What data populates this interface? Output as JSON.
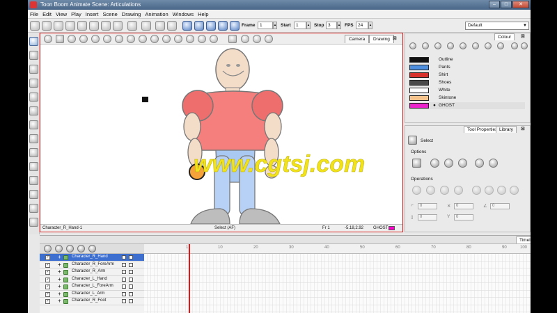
{
  "window": {
    "title": "Toon Boom Animate Scene: Articulations"
  },
  "menu": [
    "File",
    "Edit",
    "View",
    "Play",
    "Insert",
    "Scene",
    "Drawing",
    "Animation",
    "Windows",
    "Help"
  ],
  "toolbar": {
    "frame_label": "Frame",
    "frame_value": "1",
    "start_label": "Start",
    "start_value": "1",
    "stop_label": "Stop",
    "stop_value": "3",
    "fps_label": "FPS",
    "fps_value": "24",
    "workspace": "Default"
  },
  "view": {
    "tabs": [
      "Camera",
      "Drawing"
    ],
    "selected_tab": "Drawing",
    "status_left": "Character_R_Hand-1",
    "status_tool": "Select (AF)",
    "status_frame": "Fr 1",
    "status_coords": "-5.18,2.92",
    "status_color": "GHOST"
  },
  "colour_panel": {
    "tab": "Colour",
    "swatches": [
      {
        "name": "Outline",
        "color": "#111111"
      },
      {
        "name": "Pants",
        "color": "#4f8fe0"
      },
      {
        "name": "Shirt",
        "color": "#d8302a"
      },
      {
        "name": "Shoes",
        "color": "#4a4a4a"
      },
      {
        "name": "White",
        "color": "#ffffff"
      },
      {
        "name": "Skintone",
        "color": "#f5c38b"
      },
      {
        "name": "GHOST",
        "color": "#ee22cc"
      }
    ],
    "selected": "GHOST"
  },
  "tool_panel": {
    "tabs": [
      "Tool Properties",
      "Library"
    ],
    "tool_name": "Select",
    "options_label": "Options",
    "operations_label": "Operations",
    "fields": [
      "0",
      "0",
      "0",
      "0",
      "0",
      "0",
      "0",
      "0"
    ]
  },
  "timeline": {
    "tab": "Timeline",
    "ruler": [
      "1",
      "10",
      "20",
      "30",
      "40",
      "50",
      "60",
      "70",
      "80",
      "90",
      "100"
    ],
    "layers": [
      "Character_R_Hand",
      "Character_R_ForeArm",
      "Character_R_Arm",
      "Character_L_Hand",
      "Character_L_ForeArm",
      "Character_L_Arm",
      "Character_R_Foot"
    ],
    "selected_layer": "Character_R_Hand"
  },
  "watermark": "www.cgtsj.com"
}
